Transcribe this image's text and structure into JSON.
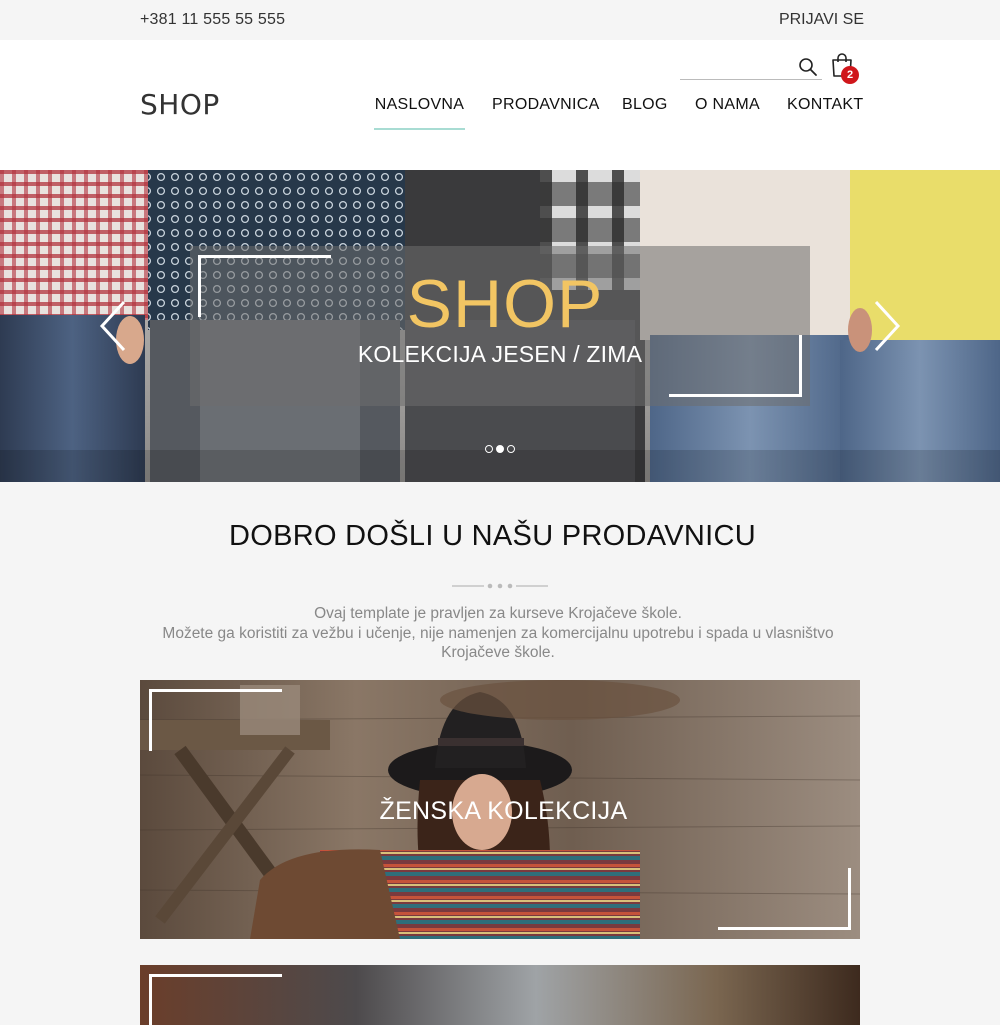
{
  "topbar": {
    "phone": "+381 11 555 55 555",
    "login": "PRIJAVI SE"
  },
  "header": {
    "logo": "SHOP",
    "search_placeholder": "",
    "cart_count": "2",
    "nav": [
      {
        "label": "NASLOVNA",
        "active": true
      },
      {
        "label": "PRODAVNICA"
      },
      {
        "label": "BLOG"
      },
      {
        "label": "O NAMA"
      },
      {
        "label": "KONTAKT"
      }
    ],
    "nav_active_color": "#a8dcd3"
  },
  "hero": {
    "title": "SHOP",
    "subtitle": "KOLEKCIJA JESEN / ZIMA",
    "title_color": "#f2c563",
    "slide_count": 3,
    "active_slide": 2
  },
  "welcome": {
    "title": "DOBRO DOŠLI U NAŠU PRODAVNICU",
    "lines": [
      "Ovaj template je pravljen za kurseve Krojačeve škole.",
      "Možete ga koristiti za vežbu i učenje, nije namenjen za komercijalnu upotrebu i spada u vlasništvo",
      "Krojačeve škole."
    ]
  },
  "collections": [
    {
      "label": "ŽENSKA KOLEKCIJA"
    },
    {
      "label": ""
    }
  ],
  "icons": {
    "search": "search-icon",
    "cart": "shopping-bag-icon",
    "prev": "chevron-left-icon",
    "next": "chevron-right-icon"
  },
  "colors": {
    "badge": "#d0161b",
    "text_muted": "#888888",
    "background": "#f5f5f5"
  }
}
